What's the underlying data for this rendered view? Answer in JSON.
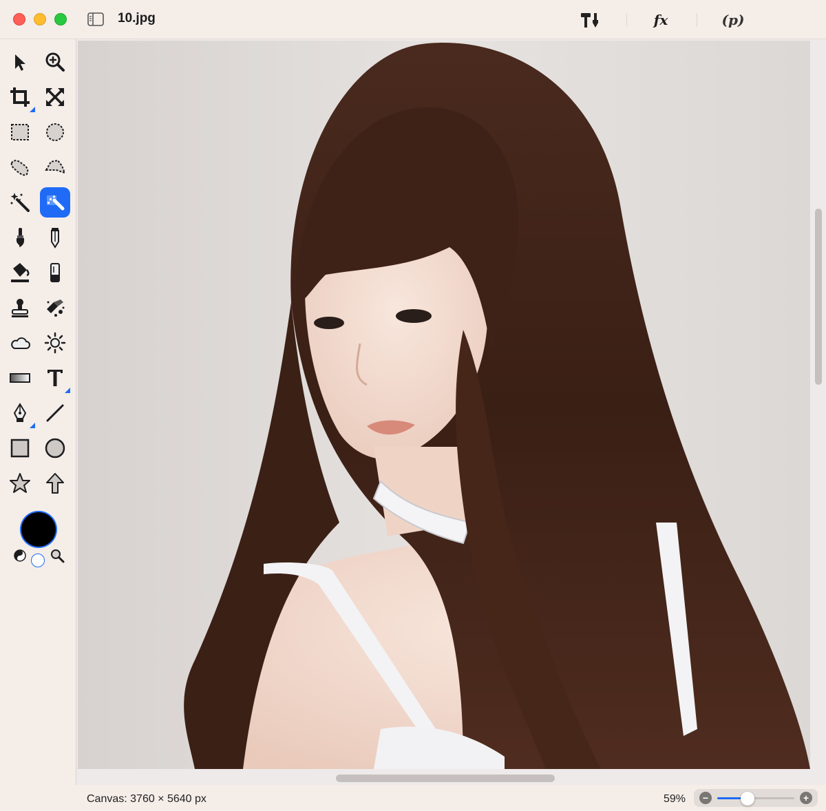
{
  "window": {
    "title": "10.jpg",
    "toolbar": {
      "tools_icon": "hammer-brush-icon",
      "effects_label": "fx",
      "parameters_label": "(p)"
    }
  },
  "tools": [
    {
      "name": "arrow",
      "icon": "arrow-select-icon"
    },
    {
      "name": "zoom",
      "icon": "zoom-in-icon"
    },
    {
      "name": "crop",
      "icon": "crop-icon"
    },
    {
      "name": "resize",
      "icon": "arrows-expand-icon"
    },
    {
      "name": "rect-select",
      "icon": "rect-select-icon"
    },
    {
      "name": "ellipse-select",
      "icon": "ellipse-select-icon"
    },
    {
      "name": "lasso",
      "icon": "lasso-icon"
    },
    {
      "name": "polygon-lasso",
      "icon": "polygon-lasso-icon"
    },
    {
      "name": "magic-wand",
      "icon": "magic-wand-icon"
    },
    {
      "name": "smart-select",
      "icon": "smart-brush-select-icon",
      "selected": true
    },
    {
      "name": "brush",
      "icon": "brush-icon"
    },
    {
      "name": "pencil",
      "icon": "pencil-icon"
    },
    {
      "name": "paint-bucket",
      "icon": "paint-bucket-icon"
    },
    {
      "name": "eraser",
      "icon": "eraser-icon"
    },
    {
      "name": "clone-stamp",
      "icon": "stamp-icon"
    },
    {
      "name": "retouch",
      "icon": "retouch-icon"
    },
    {
      "name": "smudge",
      "icon": "cloud-icon"
    },
    {
      "name": "light",
      "icon": "sun-icon"
    },
    {
      "name": "gradient",
      "icon": "gradient-icon"
    },
    {
      "name": "text",
      "icon": "text-icon"
    },
    {
      "name": "pen",
      "icon": "pen-nib-icon"
    },
    {
      "name": "line",
      "icon": "line-icon"
    },
    {
      "name": "rectangle",
      "icon": "square-icon"
    },
    {
      "name": "ellipse",
      "icon": "circle-icon"
    },
    {
      "name": "star",
      "icon": "star-icon"
    },
    {
      "name": "arrow-shape",
      "icon": "arrow-up-icon"
    }
  ],
  "colors": {
    "accent": "#1f6bf5",
    "primary_color": "#000000",
    "secondary_color": "#ffffff"
  },
  "status": {
    "canvas_info": "Canvas: 3760 × 5640 px",
    "zoom_label": "59%",
    "zoom_level": 0.59
  }
}
